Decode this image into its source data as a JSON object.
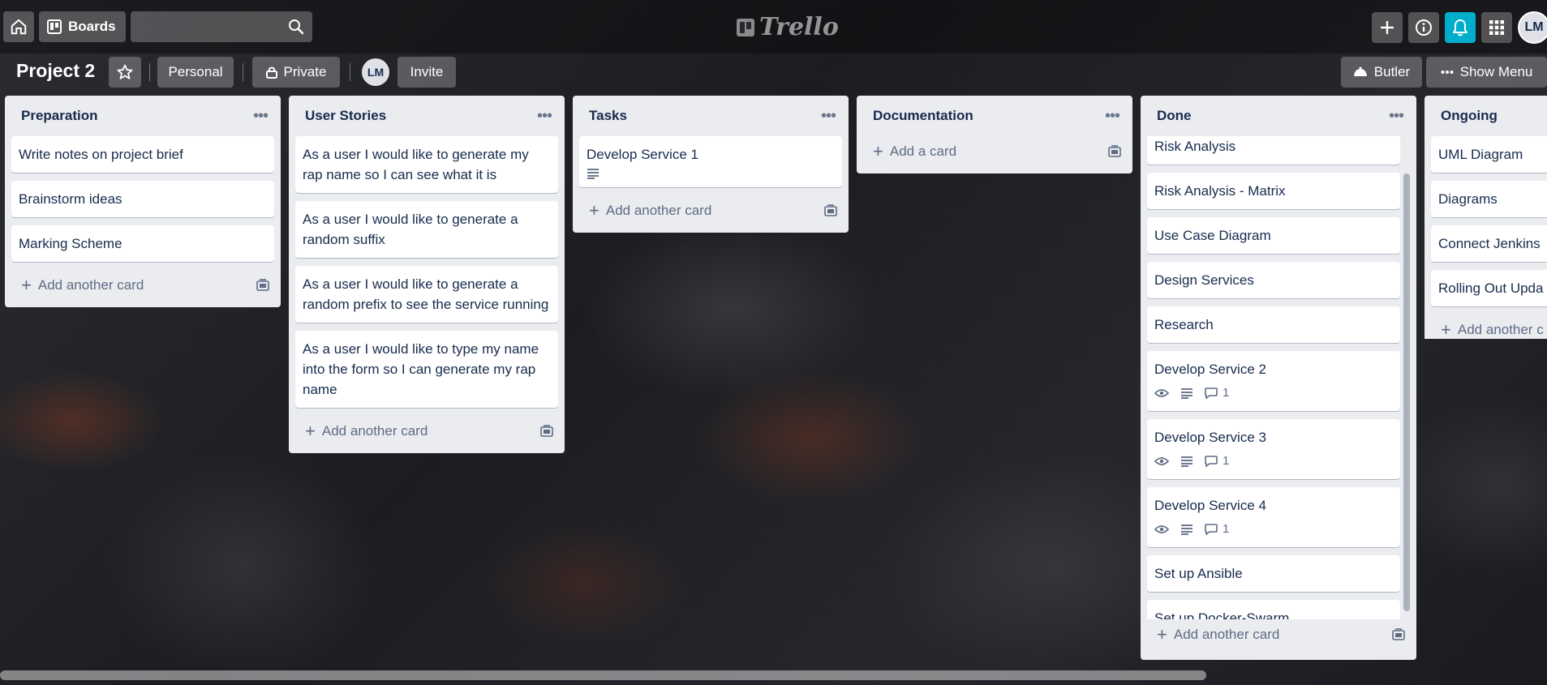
{
  "topbar": {
    "home_icon": "home-icon",
    "boards_label": "Boards",
    "search_placeholder": "",
    "logo_text": "Trello",
    "avatar_initials": "LM"
  },
  "board": {
    "title": "Project 2",
    "visibility_team": "Personal",
    "visibility_privacy": "Private",
    "member_initials": "LM",
    "invite_label": "Invite",
    "butler_label": "Butler",
    "show_menu_label": "Show Menu"
  },
  "lists": [
    {
      "title": "Preparation",
      "cards": [
        "Write notes on project brief",
        "Brainstorm ideas",
        "Marking Scheme"
      ],
      "add_label": "Add another card"
    },
    {
      "title": "User Stories",
      "cards": [
        "As a user I would like to generate my rap name so I can see what it is",
        "As a user I would like to generate a random suffix",
        "As a user I would like to generate a random prefix to see the service running",
        "As a user I would like to type my name into the form so I can generate my rap name"
      ],
      "add_label": "Add another card"
    },
    {
      "title": "Tasks",
      "cards": [
        "Develop Service 1"
      ],
      "add_label": "Add another card"
    },
    {
      "title": "Documentation",
      "cards": [],
      "add_label": "Add a card"
    },
    {
      "title": "Done",
      "cards": [
        "Risk Analysis",
        "Risk Analysis - Matrix",
        "Use Case Diagram",
        "Design Services",
        "Research",
        "Develop Service 2",
        "Develop Service 3",
        "Develop Service 4",
        "Set up Ansible",
        "Set up Docker-Swarm"
      ],
      "comment_count": "1",
      "add_label": "Add another card"
    },
    {
      "title": "Ongoing",
      "cards": [
        "UML Diagram",
        "Diagrams",
        "Connect Jenkins",
        "Rolling Out Upda"
      ],
      "add_label": "Add another c"
    }
  ],
  "colors": {
    "list_bg": "#ebecf0",
    "card_bg": "#ffffff",
    "notification_accent": "#00aecc",
    "text_primary": "#172b4d",
    "text_muted": "#5e6c84"
  }
}
